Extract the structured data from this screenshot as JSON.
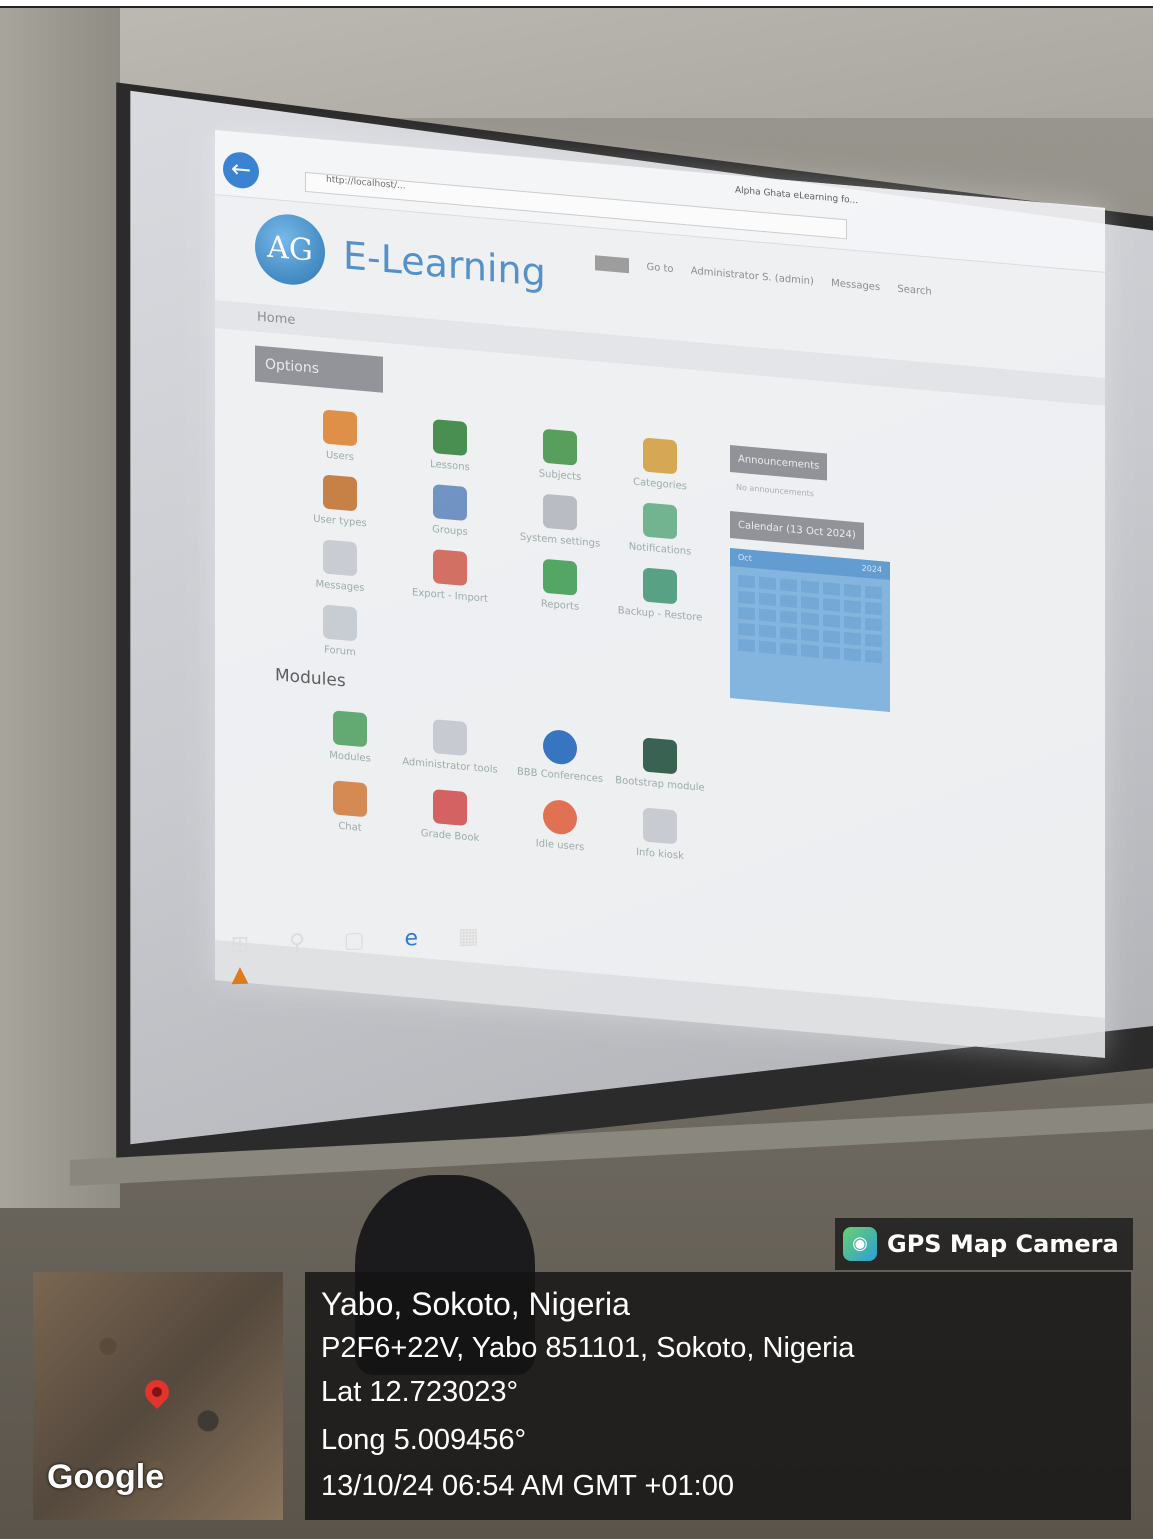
{
  "projected_page": {
    "url": "http://localhost/...",
    "tab_title": "Alpha Ghata eLearning fo...",
    "site_title": "E-Learning",
    "logo_text": "AG",
    "nav": [
      "Go to",
      "Administrator S. (admin)",
      "Messages",
      "Search"
    ],
    "home": "Home",
    "options_tab": "Options",
    "options": [
      "Users",
      "Lessons",
      "Subjects",
      "Categories",
      "User types",
      "Groups",
      "System settings",
      "Notifications",
      "Messages",
      "Export - Import",
      "Reports",
      "Backup - Restore",
      "Forum"
    ],
    "modules_heading": "Modules",
    "modules": [
      "Modules",
      "Administrator tools",
      "BBB Conferences",
      "Bootstrap module",
      "Chat",
      "Grade Book",
      "Idle users",
      "Info kiosk"
    ],
    "announcements_tab": "Announcements",
    "announcements_text": "No announcements",
    "calendar_tab": "Calendar (13 Oct 2024)",
    "calendar_month": "Oct",
    "calendar_year": "2024"
  },
  "overlay": {
    "app_label": "GPS Map Camera",
    "map_label": "Google",
    "place": "Yabo, Sokoto, Nigeria",
    "address": "P2F6+22V, Yabo 851101, Sokoto, Nigeria",
    "lat": "Lat 12.723023°",
    "long": "Long 5.009456°",
    "datetime": "13/10/24 06:54 AM GMT +01:00"
  }
}
